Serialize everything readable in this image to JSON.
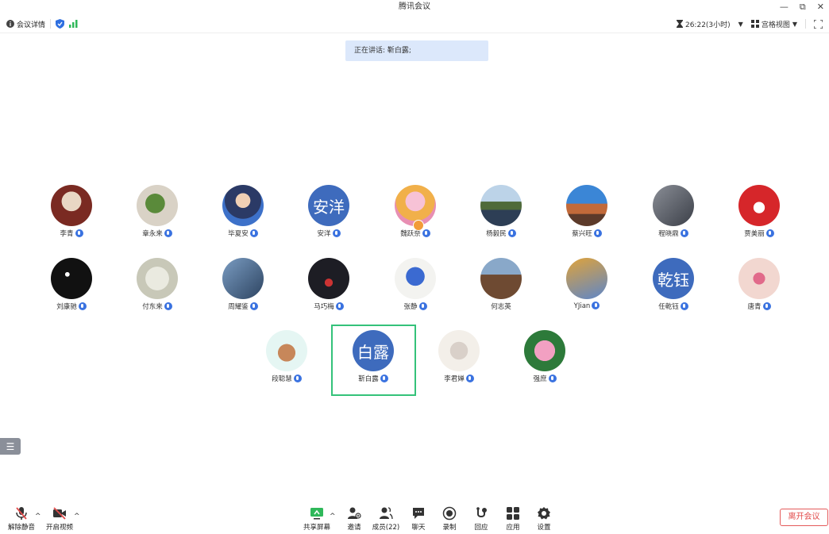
{
  "window": {
    "title": "腾讯会议",
    "min": "—",
    "restore": "⧉",
    "close": "✕"
  },
  "infobar": {
    "meeting_details": "会议详情",
    "timer": "26:22(3小时)",
    "view_mode": "宫格视图"
  },
  "speaking": "正在讲话: 靳白露;",
  "participants": [
    {
      "name": "李青",
      "mic": true
    },
    {
      "name": "章永来",
      "mic": true
    },
    {
      "name": "毕夏安",
      "mic": true
    },
    {
      "name": "安洋",
      "mic": true,
      "avatar_text": "安洋"
    },
    {
      "name": "魏跃奈",
      "mic": true
    },
    {
      "name": "杨毅民",
      "mic": true
    },
    {
      "name": "蔡兴旺",
      "mic": true
    },
    {
      "name": "程晓鼎",
      "mic": true
    },
    {
      "name": "贾美丽",
      "mic": true
    },
    {
      "name": "刘康驰",
      "mic": true
    },
    {
      "name": "付东来",
      "mic": true
    },
    {
      "name": "周耀鉴",
      "mic": true
    },
    {
      "name": "马巧梅",
      "mic": true
    },
    {
      "name": "张静",
      "mic": true
    },
    {
      "name": "何志英",
      "mic": false
    },
    {
      "name": "YJian",
      "mic": true
    },
    {
      "name": "任乾钰",
      "mic": true,
      "avatar_text": "乾钰"
    },
    {
      "name": "唐青",
      "mic": true
    },
    {
      "name": "段聪慧",
      "mic": true
    },
    {
      "name": "靳白露",
      "mic": true,
      "avatar_text": "白露"
    },
    {
      "name": "李君婵",
      "mic": true
    },
    {
      "name": "强庶",
      "mic": true
    }
  ],
  "toolbar": {
    "unmute": "解除静音",
    "start_video": "开启视频",
    "share_screen": "共享屏幕",
    "invite": "邀请",
    "members": "成员(22)",
    "chat": "聊天",
    "record": "录制",
    "react": "回应",
    "apps": "应用",
    "settings": "设置",
    "leave": "离开会议"
  },
  "colors": {
    "accent": "#3a72e0",
    "speaker_border": "#34c27a",
    "leave": "#e24b4b",
    "avatar_bg": "#3e6bbd"
  }
}
